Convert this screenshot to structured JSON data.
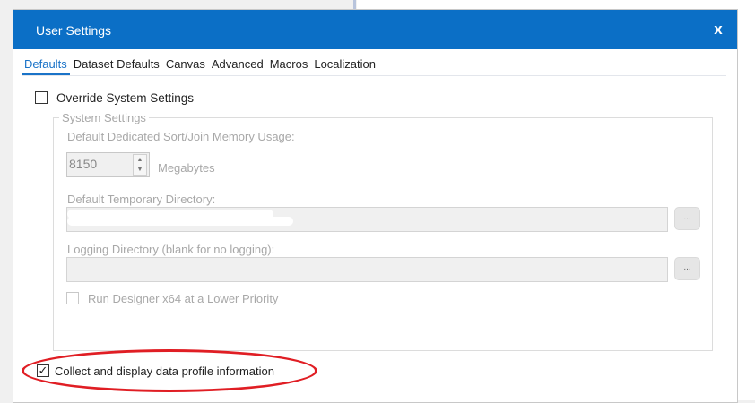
{
  "dialog": {
    "title": "User Settings",
    "close_label": "x"
  },
  "tabs": [
    {
      "label": "Defaults",
      "active": true
    },
    {
      "label": "Dataset Defaults"
    },
    {
      "label": "Canvas"
    },
    {
      "label": "Advanced"
    },
    {
      "label": "Macros"
    },
    {
      "label": "Localization"
    }
  ],
  "override": {
    "label": "Override System Settings",
    "checked": false
  },
  "system_settings": {
    "legend": "System Settings",
    "memory_label": "Default Dedicated Sort/Join Memory Usage:",
    "memory_value": "8150",
    "memory_unit": "Megabytes",
    "temp_dir_label": "Default Temporary Directory:",
    "logging_dir_label": "Logging Directory (blank for no logging):",
    "browse_label": "...",
    "lower_priority_label": "Run Designer x64 at a Lower Priority"
  },
  "profile": {
    "label": "Collect and display data profile information",
    "checked": true
  },
  "colors": {
    "titlebar": "#0b6fc6",
    "highlight": "#e01e24"
  }
}
